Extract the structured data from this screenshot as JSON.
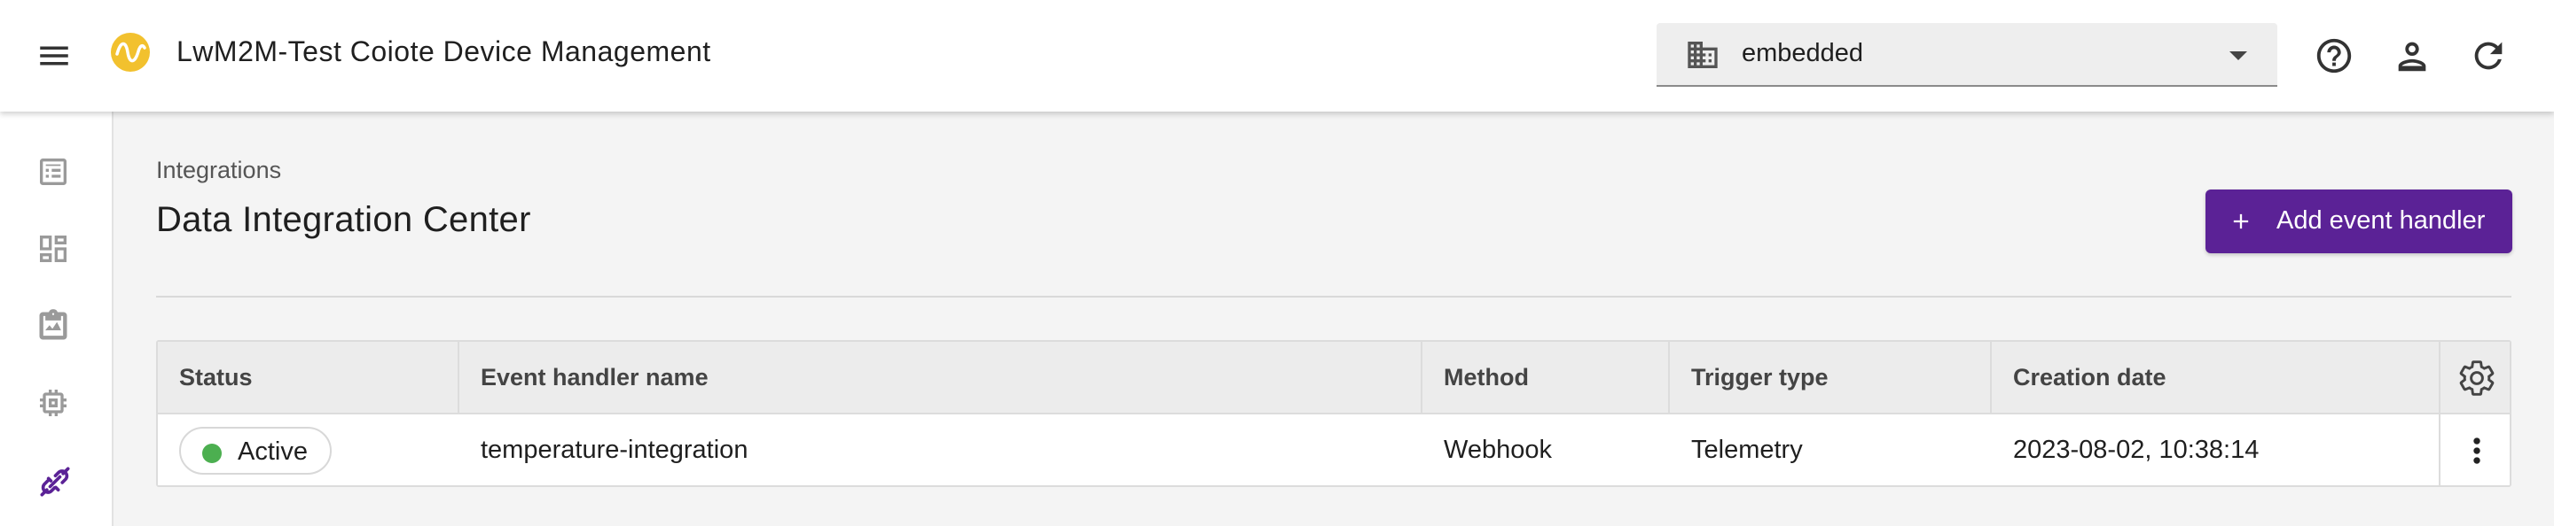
{
  "header": {
    "app_title": "LwM2M-Test Coiote Device Management",
    "tenant": {
      "value": "embedded"
    },
    "icons": [
      "menu-icon",
      "app-logo-icon",
      "building-icon",
      "help-icon",
      "account-icon",
      "refresh-icon"
    ]
  },
  "sidebar": {
    "items": [
      {
        "icon": "table-icon"
      },
      {
        "icon": "dashboard-icon"
      },
      {
        "icon": "monitoring-clipboard-icon"
      },
      {
        "icon": "chip-icon"
      },
      {
        "icon": "integration-link-icon",
        "active": true
      }
    ]
  },
  "main": {
    "breadcrumb": "Integrations",
    "title": "Data Integration Center",
    "add_button_label": "Add event handler",
    "table": {
      "columns": [
        "Status",
        "Event handler name",
        "Method",
        "Trigger type",
        "Creation date"
      ],
      "rows": [
        {
          "status": "Active",
          "name": "temperature-integration",
          "method": "Webhook",
          "trigger": "Telemetry",
          "created": "2023-08-02, 10:38:14"
        }
      ]
    }
  },
  "colors": {
    "accent": "#5b2296",
    "status_active": "#4caf50",
    "logo": "#f2c12e"
  }
}
